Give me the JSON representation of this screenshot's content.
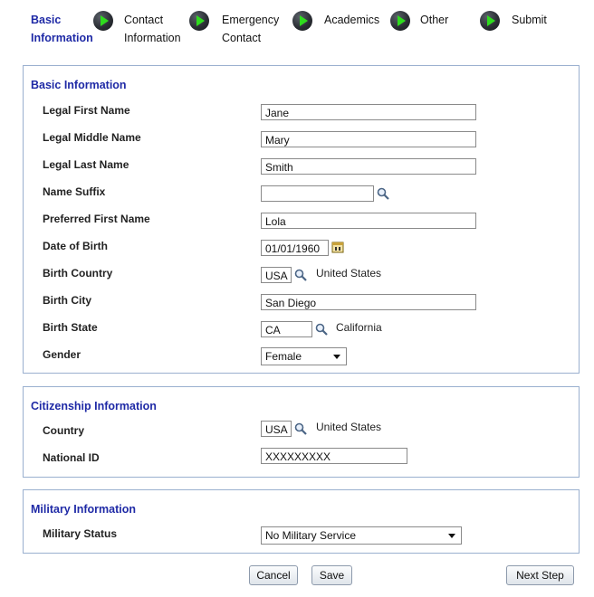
{
  "stepper": {
    "steps": [
      {
        "label_line1": "Basic",
        "label_line2": "Information"
      },
      {
        "label_line1": "Contact",
        "label_line2": "Information"
      },
      {
        "label_line1": "Emergency",
        "label_line2": "Contact"
      },
      {
        "label_line1": "Academics",
        "label_line2": ""
      },
      {
        "label_line1": "Other",
        "label_line2": ""
      },
      {
        "label_line1": "Submit",
        "label_line2": ""
      }
    ]
  },
  "basic": {
    "title": "Basic Information",
    "legal_first_name": {
      "label": "Legal First Name",
      "value": "Jane"
    },
    "legal_middle_name": {
      "label": "Legal Middle Name",
      "value": "Mary"
    },
    "legal_last_name": {
      "label": "Legal Last Name",
      "value": "Smith"
    },
    "name_suffix": {
      "label": "Name Suffix",
      "value": ""
    },
    "preferred_first_name": {
      "label": "Preferred First Name",
      "value": "Lola"
    },
    "date_of_birth": {
      "label": "Date of Birth",
      "value": "01/01/1960"
    },
    "birth_country": {
      "label": "Birth Country",
      "value": "USA",
      "description": "United States"
    },
    "birth_city": {
      "label": "Birth City",
      "value": "San Diego"
    },
    "birth_state": {
      "label": "Birth State",
      "value": "CA",
      "description": "California"
    },
    "gender": {
      "label": "Gender",
      "value": "Female"
    }
  },
  "citizenship": {
    "title": "Citizenship Information",
    "country": {
      "label": "Country",
      "value": "USA",
      "description": "United States"
    },
    "national_id": {
      "label": "National ID",
      "value": "XXXXXXXXX"
    }
  },
  "military": {
    "title": "Military Information",
    "status": {
      "label": "Military Status",
      "value": "No Military Service"
    }
  },
  "buttons": {
    "cancel": "Cancel",
    "save": "Save",
    "next": "Next Step"
  },
  "colors": {
    "accent": "#1f2aa6",
    "panel_border": "#9ab0cf",
    "step_arrow": "#2fdc1e"
  }
}
